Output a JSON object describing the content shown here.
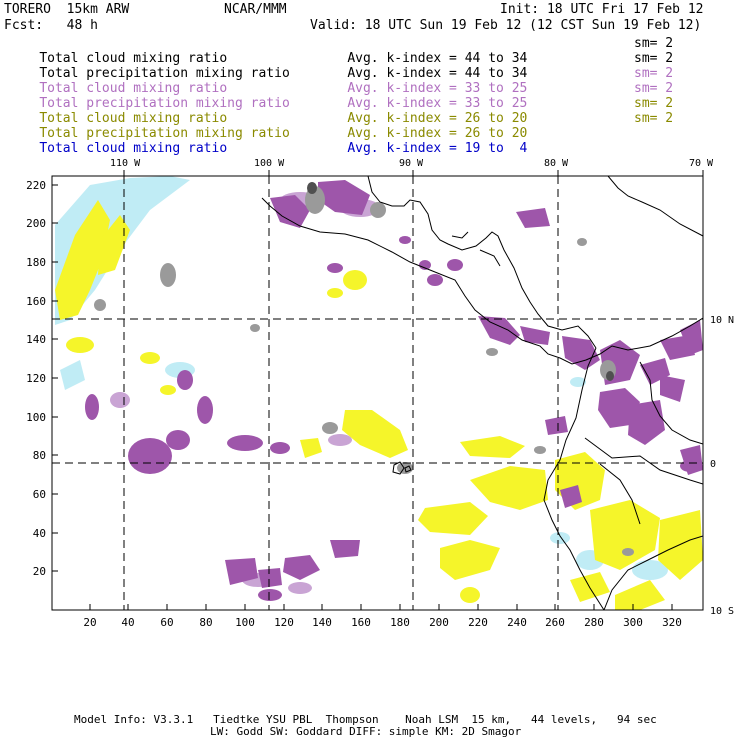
{
  "header": {
    "model": "TORERO  15km ARW",
    "center": "NCAR/MMM",
    "init": "Init: 18 UTC Fri 17 Feb 12",
    "fcst": "Fcst:   48 h",
    "valid": "Valid: 18 UTC Sun 19 Feb 12 (12 CST Sun 19 Feb 12)"
  },
  "legend": [
    {
      "field": "Total cloud mixing ratio",
      "kindex": "Avg. k-index = ",
      "from": "44",
      "to_word": "to",
      "to": "34",
      "sm": "sm= 2",
      "color": "#000000"
    },
    {
      "field": "Total precipitation mixing ratio",
      "kindex": "Avg. k-index = ",
      "from": "44",
      "to_word": "to",
      "to": "34",
      "sm": "sm= 2",
      "color": "#000000"
    },
    {
      "field": "Total cloud mixing ratio",
      "kindex": "Avg. k-index = ",
      "from": "33",
      "to_word": "to",
      "to": "25",
      "sm": "sm= 2",
      "color": "#b070c0"
    },
    {
      "field": "Total precipitation mixing ratio",
      "kindex": "Avg. k-index = ",
      "from": "33",
      "to_word": "to",
      "to": "25",
      "sm": "sm= 2",
      "color": "#b070c0"
    },
    {
      "field": "Total cloud mixing ratio",
      "kindex": "Avg. k-index = ",
      "from": "26",
      "to_word": "to",
      "to": "20",
      "sm": "sm= 2",
      "color": "#8a8a00"
    },
    {
      "field": "Total precipitation mixing ratio",
      "kindex": "Avg. k-index = ",
      "from": "26",
      "to_word": "to",
      "to": "20",
      "sm": "sm= 2",
      "color": "#8a8a00"
    },
    {
      "field": "Total cloud mixing ratio",
      "kindex": "Avg. k-index = ",
      "from": "19",
      "to_word": "to",
      "to": " 4",
      "sm": "",
      "color": "#0000c8"
    }
  ],
  "map": {
    "lon_labels": [
      "110 W",
      "100 W",
      "90 W",
      "80 W",
      "70 W"
    ],
    "lat_labels": [
      "10 N",
      "0",
      "10 S"
    ],
    "y_ticks": [
      "20",
      "40",
      "60",
      "80",
      "100",
      "120",
      "140",
      "160",
      "180",
      "200",
      "220"
    ],
    "x_ticks": [
      "20",
      "40",
      "60",
      "80",
      "100",
      "120",
      "140",
      "160",
      "180",
      "200",
      "220",
      "240",
      "260",
      "280",
      "300",
      "320"
    ],
    "colors": {
      "deep": "#9e56aa",
      "light": "#c9a4d4",
      "yellow": "#f5f52a",
      "cyan": "#c0ecf5",
      "gray": "#9a9a9a",
      "darkgray": "#505050"
    }
  },
  "footer": {
    "line1": "Model Info: V3.3.1   Tiedtke YSU PBL  Thompson    Noah LSM  15 km,   44 levels,   94 sec",
    "line2": "LW: Godd SW: Goddard DIFF: simple KM: 2D Smagor"
  }
}
